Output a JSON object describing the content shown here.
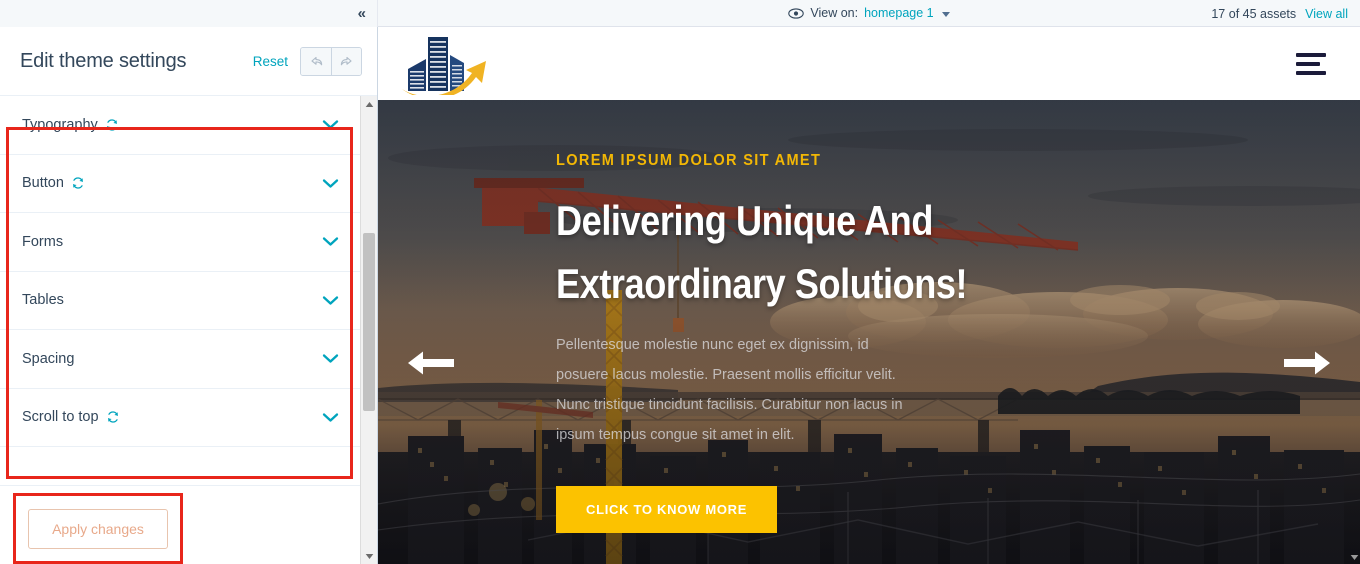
{
  "topbar": {
    "collapse_icon": "chevron-double-left-icon",
    "eye_icon": "eye-icon",
    "view_on_label": "View on:",
    "view_on_value": "homepage 1",
    "assets_count": "17 of 45 assets",
    "view_all": "View all"
  },
  "sidebar": {
    "title": "Edit theme settings",
    "reset_label": "Reset",
    "undo_icon": "undo-arrow-icon",
    "redo_icon": "redo-arrow-icon",
    "apply_label": "Apply changes",
    "items": [
      {
        "label": "Typography",
        "has_refresh": true,
        "refresh_icon": "refresh-icon",
        "chevron": "chevron-down-icon"
      },
      {
        "label": "Button",
        "has_refresh": true,
        "refresh_icon": "refresh-icon",
        "chevron": "chevron-down-icon"
      },
      {
        "label": "Forms",
        "has_refresh": false,
        "refresh_icon": "",
        "chevron": "chevron-down-icon"
      },
      {
        "label": "Tables",
        "has_refresh": false,
        "refresh_icon": "",
        "chevron": "chevron-down-icon"
      },
      {
        "label": "Spacing",
        "has_refresh": false,
        "refresh_icon": "",
        "chevron": "chevron-down-icon"
      },
      {
        "label": "Scroll to top",
        "has_refresh": true,
        "refresh_icon": "refresh-icon",
        "chevron": "chevron-down-icon"
      }
    ]
  },
  "preview": {
    "logo_name": "building-company-logo",
    "menu_icon": "hamburger-menu-icon",
    "hero": {
      "eyebrow": "LOREM IPSUM DOLOR SIT AMET",
      "title_line1": "Delivering Unique And",
      "title_line2": "Extraordinary Solutions!",
      "body": "Pellentesque molestie nunc eget ex dignissim, id posuere lacus molestie. Praesent mollis efficitur velit. Nunc tristique tincidunt facilisis. Curabitur non lacus in ipsum tempus congue sit amet in elit.",
      "cta_label": "CLICK TO KNOW MORE",
      "prev_icon": "arrow-left-icon",
      "next_icon": "arrow-right-icon"
    }
  },
  "colors": {
    "teal_accent": "#00a4bd",
    "dark_slate": "#33475b",
    "highlight_red": "#e8261b",
    "hero_yellow": "#f2b705",
    "cta_yellow": "#fcc200",
    "apply_orange": "#e8a98a"
  }
}
